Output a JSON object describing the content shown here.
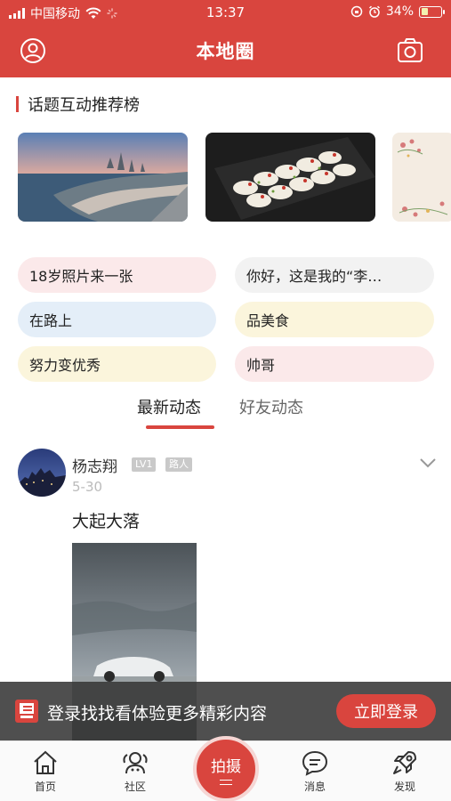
{
  "status_bar": {
    "carrier": "中国移动",
    "time": "13:37",
    "battery_percent": "34%",
    "battery_level": 0.34
  },
  "header": {
    "title": "本地圈",
    "left_icon": "profile-icon",
    "right_icon": "camera-icon"
  },
  "topics": {
    "title": "话题互动推荐榜",
    "cards": [
      {
        "name": "city-coast-photo"
      },
      {
        "name": "food-dumplings-photo"
      },
      {
        "name": "floral-pattern-photo"
      }
    ],
    "tags": [
      {
        "label": "18岁照片来一张",
        "color": "#fbe9ea"
      },
      {
        "label": "你好，这是我的“李…",
        "color": "#f2f2f2"
      },
      {
        "label": "在路上",
        "color": "#e4eef8"
      },
      {
        "label": "品美食",
        "color": "#fbf5dc"
      },
      {
        "label": "努力变优秀",
        "color": "#fbf5dc"
      },
      {
        "label": "帅哥",
        "color": "#fbe9ea"
      }
    ]
  },
  "feed_tabs": {
    "active": "最新动态",
    "inactive": "好友动态"
  },
  "post": {
    "author": "杨志翔",
    "level": "LV1",
    "role": "路人",
    "date": "5-30",
    "text": "大起大落"
  },
  "login_banner": {
    "text": "登录找找看体验更多精彩内容",
    "button": "立即登录",
    "logo_text": "找找看"
  },
  "bottom_nav": {
    "items": [
      {
        "label": "首页",
        "icon": "home-icon"
      },
      {
        "label": "社区",
        "icon": "community-icon"
      },
      {
        "label": "拍摄",
        "icon": "shoot-icon"
      },
      {
        "label": "消息",
        "icon": "message-icon"
      },
      {
        "label": "发现",
        "icon": "rocket-icon"
      }
    ]
  },
  "colors": {
    "brand_red": "#d9453e"
  }
}
